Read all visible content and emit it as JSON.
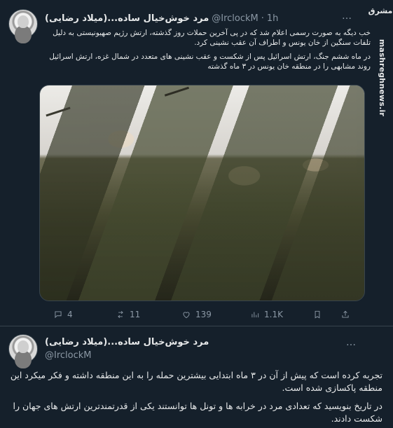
{
  "tweet1": {
    "author_name": "مرد خوش‌خیال ساده...(میلاد رضایی)",
    "handle": "@IrclockM",
    "time": "1h",
    "more": "…",
    "paragraph1": "خب دیگه به صورت رسمی اعلام شد که در پی آخرین حملات روز گذشته، ارتش رژیم صهیونیستی به دلیل تلفات سنگین از خان یونس و اطراف آن عقب نشینی کرد.",
    "paragraph2": "در ماه ششم جنگ، ارتش اسرائیل پس از شکست و عقب نشینی های متعدد در شمال غزه، ارتش اسرائیل روند مشابهی را در منطقه خان یونس در ۳ ماه گذشته",
    "stats": {
      "replies": "4",
      "reposts": "11",
      "likes": "139",
      "views": "1.1K"
    }
  },
  "watermark": {
    "brand": "مشرق",
    "site": "mashreghnews.ir"
  },
  "tweet2": {
    "author_name": "مرد خوش‌خیال ساده...(میلاد رضایی)",
    "handle": "@IrclockM",
    "more": "…",
    "paragraph1": "تجربه کرده است که پیش از آن در ۳ ماه ابتدایی بیشترین حمله را به این منطقه داشته و فکر میکرد این منطقه پاکسازی شده است.",
    "paragraph2": "در تاریخ بنویسید که تعدادی مرد در خرابه ها و تونل ها توانستند یکی از قدرتمندترین ارتش های جهان را شکست دادند."
  },
  "icons": {
    "reply": "comment-icon",
    "repost": "repost-icon",
    "like": "heart-icon",
    "views": "views-icon",
    "bookmark": "bookmark-icon",
    "share": "share-icon"
  }
}
